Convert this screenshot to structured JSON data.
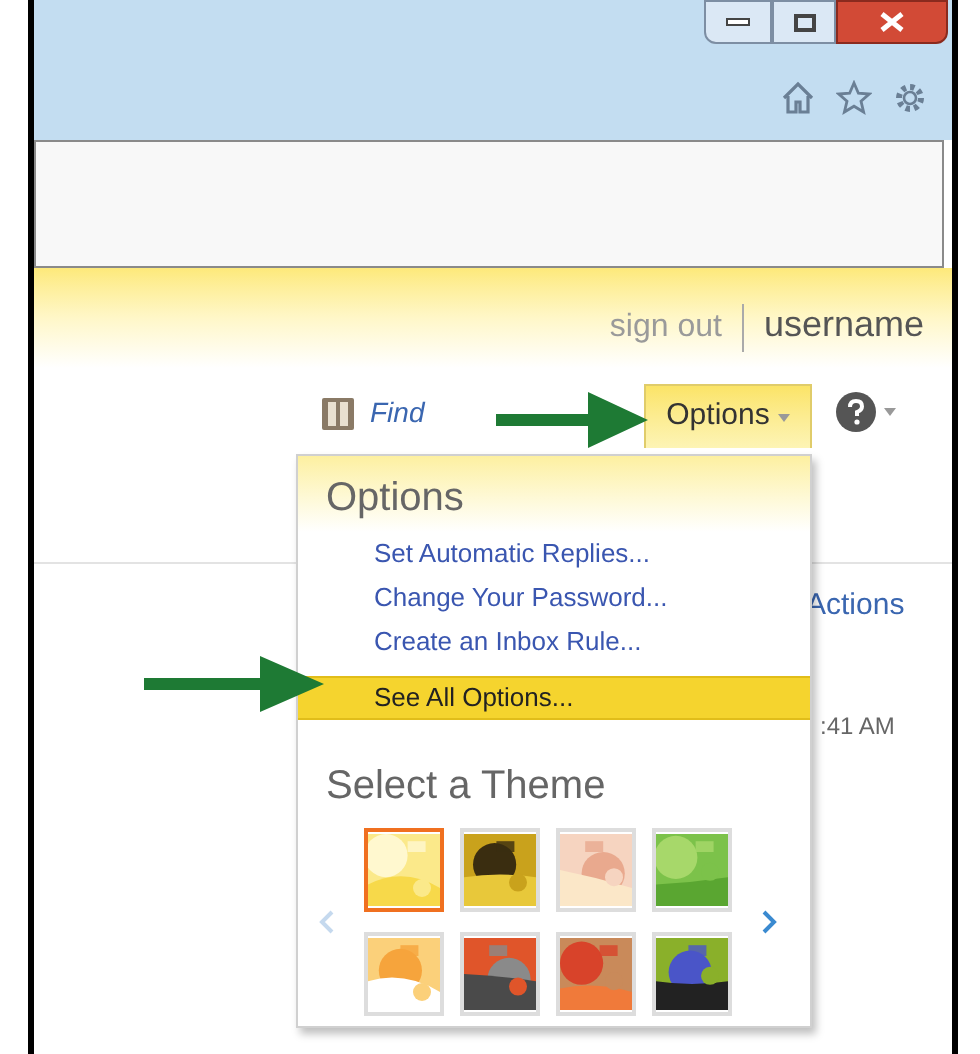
{
  "header": {
    "sign_out": "sign out",
    "username": "username"
  },
  "toolbar": {
    "find_label": "Find",
    "options_button": {
      "label": "Options",
      "open": true
    }
  },
  "options_menu": {
    "title": "Options",
    "items": [
      {
        "label": "Set Automatic Replies...",
        "selected": false
      },
      {
        "label": "Change Your Password...",
        "selected": false
      },
      {
        "label": "Create an Inbox Rule...",
        "selected": false
      },
      {
        "label": "See All Options...",
        "selected": true
      }
    ],
    "theme_heading": "Select a Theme",
    "prev_disabled": true,
    "themes": [
      {
        "kind": "picture",
        "selected": true
      },
      {
        "kind": "picture",
        "selected": false
      },
      {
        "kind": "picture",
        "selected": false
      },
      {
        "kind": "picture",
        "selected": false
      },
      {
        "kind": "picture",
        "selected": false
      },
      {
        "kind": "picture",
        "selected": false
      },
      {
        "kind": "picture",
        "selected": false
      },
      {
        "kind": "picture",
        "selected": false
      }
    ]
  },
  "background": {
    "actions": "Actions",
    "time": ":41 AM"
  }
}
